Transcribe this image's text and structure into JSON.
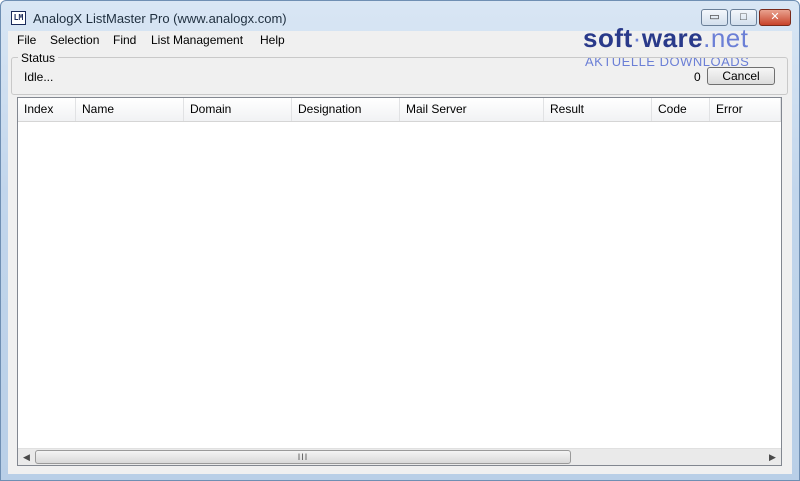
{
  "window": {
    "title": "AnalogX ListMaster Pro (www.analogx.com)",
    "icon": "app-logo-icon",
    "icon_text": "LM"
  },
  "caption_buttons": {
    "minimize_glyph": "▭",
    "maximize_glyph": "□",
    "close_glyph": "✕"
  },
  "menubar": {
    "items": [
      "File",
      "Selection",
      "Find",
      "List Management",
      "Help"
    ]
  },
  "watermark": {
    "main_a": "soft",
    "main_sep": "·",
    "main_b": "ware",
    "main_c": ".net",
    "sub": "AKTUELLE DOWNLOADS"
  },
  "status": {
    "legend": "Status",
    "text": "Idle...",
    "count": "0",
    "cancel_label": "Cancel"
  },
  "listview": {
    "columns": [
      "Index",
      "Name",
      "Domain",
      "Designation",
      "Mail Server",
      "Result",
      "Code",
      "Error"
    ],
    "rows": []
  },
  "scrollbar": {
    "left_arrow": "◀",
    "right_arrow": "▶",
    "thumb_grip": "III"
  },
  "colors": {
    "title_bar": "#c2d6ec",
    "close_button": "#c8432a",
    "watermark_dark": "#2a3a8a",
    "watermark_light": "#6b7fd6"
  }
}
